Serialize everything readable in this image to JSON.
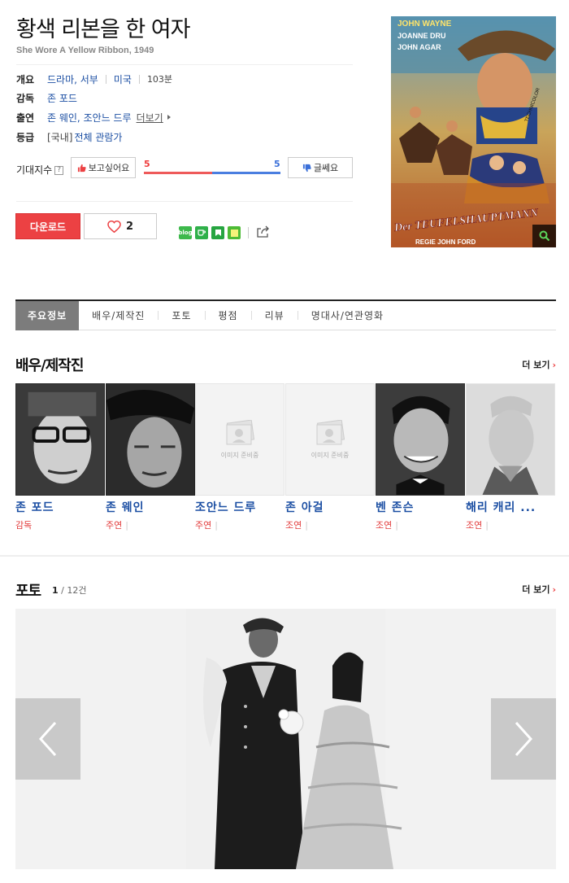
{
  "movie": {
    "title": "황색 리본을 한 여자",
    "original_title": "She Wore A Yellow Ribbon, 1949"
  },
  "info": {
    "overview_label": "개요",
    "genre": "드라마, 서부",
    "country": "미국",
    "runtime": "103분",
    "director_label": "감독",
    "director": "존 포드",
    "cast_label": "출연",
    "cast": "존 웨인, 조안느 드루",
    "cast_more": "더보기",
    "rating_label": "등급",
    "rating_region": "[국내]",
    "rating": "전체 관람가"
  },
  "expectation": {
    "label": "기대지수",
    "help": "?",
    "want_label": "보고싶어요",
    "no_label": "글쎄요",
    "want_count": "5",
    "no_count": "5",
    "want_fraction": 0.5,
    "colors": {
      "want": "#ee5a5a",
      "no": "#4a7ee0"
    }
  },
  "actions": {
    "download_label": "다운로드",
    "like_count": "2",
    "share_icons": [
      "blog-icon",
      "cafe-icon",
      "bookmark-icon",
      "memo-icon",
      "share-icon"
    ],
    "blog_text": "blog"
  },
  "tabs": [
    "주요정보",
    "배우/제작진",
    "포토",
    "평점",
    "리뷰",
    "명대사/연관영화"
  ],
  "cast_section": {
    "heading": "배우/제작진",
    "more": "더 보기",
    "people": [
      {
        "name": "존 포드",
        "role": "감독",
        "has_photo": true
      },
      {
        "name": "존 웨인",
        "role": "주연",
        "has_photo": true
      },
      {
        "name": "조안느 드루",
        "role": "주연",
        "has_photo": false
      },
      {
        "name": "존 아걸",
        "role": "조연",
        "has_photo": false
      },
      {
        "name": "벤 존슨",
        "role": "조연",
        "has_photo": true
      },
      {
        "name": "해리 캐리 ...",
        "role": "조연",
        "has_photo": true
      }
    ],
    "placeholder_text": "이미지 준비중"
  },
  "photo_section": {
    "heading": "포토",
    "current": "1",
    "total": "12건",
    "more": "더 보기"
  },
  "poster": {
    "top_credits": [
      "JOHN WAYNE",
      "JOANNE DRU",
      "JOHN AGAR"
    ],
    "big_title": "Der TEUFELSHAUPTMANN",
    "director_credit": "REGIE JOHN FORD",
    "badge": "TECHNICOLOR"
  },
  "colors": {
    "accent_red": "#ec4143",
    "link_blue": "#1c4fa3"
  }
}
